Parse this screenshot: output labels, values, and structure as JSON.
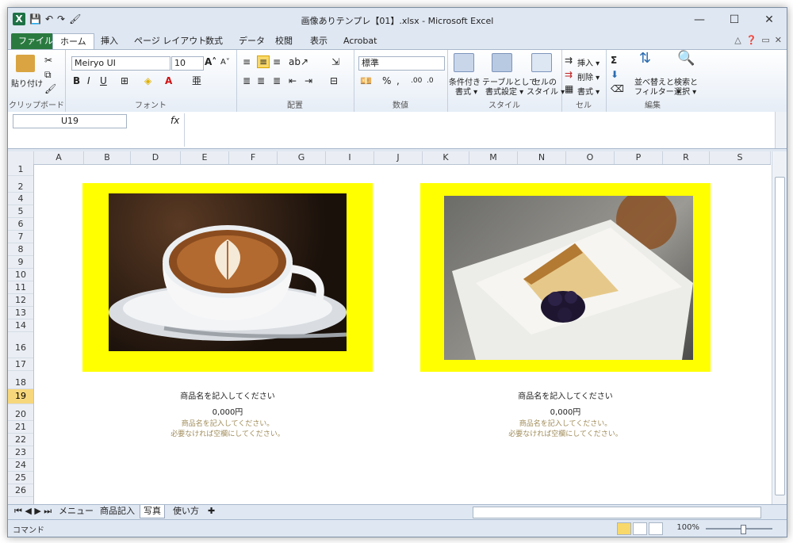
{
  "window": {
    "title": "画像ありテンプレ【01】.xlsx  -  Microsoft Excel",
    "controls": [
      "—",
      "☐",
      "✕"
    ]
  },
  "quick_access": [
    "💾",
    "↶",
    "↷",
    "🖌"
  ],
  "ribbon_tabs": [
    {
      "label": "ファイル"
    },
    {
      "label": "ホーム"
    },
    {
      "label": "挿入"
    },
    {
      "label": "ページ レイアウト"
    },
    {
      "label": "数式"
    },
    {
      "label": "データ"
    },
    {
      "label": "校閲"
    },
    {
      "label": "表示"
    },
    {
      "label": "Acrobat"
    }
  ],
  "ribbon": {
    "clipboard": {
      "paste": "貼り付け",
      "group": "クリップボード"
    },
    "font": {
      "name": "Meiryo UI",
      "size": "10",
      "group": "フォント"
    },
    "alignment": {
      "group": "配置"
    },
    "number": {
      "format": "標準",
      "group": "数値"
    },
    "styles": {
      "conditional": "条件付き",
      "conditional2": "書式 ▾",
      "table": "テーブルとして",
      "table2": "書式設定 ▾",
      "cell": "セルの",
      "cell2": "スタイル ▾",
      "group": "スタイル"
    },
    "cells": {
      "insert": "挿入 ▾",
      "delete": "削除 ▾",
      "format": "書式 ▾",
      "group": "セル"
    },
    "editing": {
      "sort": "並べ替えと",
      "sort2": "フィルター ▾",
      "find": "検索と",
      "find2": "選択 ▾",
      "group": "編集"
    }
  },
  "formula_bar": {
    "name_box": "U19",
    "fx": "fx",
    "content": ""
  },
  "columns": [
    "A",
    "B",
    "D",
    "E",
    "F",
    "G",
    "I",
    "J",
    "K",
    "M",
    "N",
    "O",
    "P",
    "R",
    "S"
  ],
  "rows": [
    "1",
    "2",
    "4",
    "5",
    "6",
    "7",
    "8",
    "9",
    "10",
    "11",
    "12",
    "13",
    "14",
    "16",
    "17",
    "18",
    "19",
    "20",
    "21",
    "22",
    "23",
    "24",
    "25",
    "26"
  ],
  "selected_row": "19",
  "products": [
    {
      "name": "商品名を記入してください",
      "price": "0,000円",
      "note1": "商品名を記入してください。",
      "note2": "必要なければ空欄にしてください。"
    },
    {
      "name": "商品名を記入してください",
      "price": "0,000円",
      "note1": "商品名を記入してください。",
      "note2": "必要なければ空欄にしてください。"
    }
  ],
  "sheet_tabs": [
    {
      "label": "メニュー"
    },
    {
      "label": "商品記入"
    },
    {
      "label": "写真"
    },
    {
      "label": "使い方"
    }
  ],
  "active_sheet": "写真",
  "status": {
    "mode": "コマンド",
    "zoom": "100%"
  },
  "colors": {
    "frame": "#ffff00",
    "file_tab": "#2a7a3f",
    "selected_row": "#f7d77c"
  }
}
